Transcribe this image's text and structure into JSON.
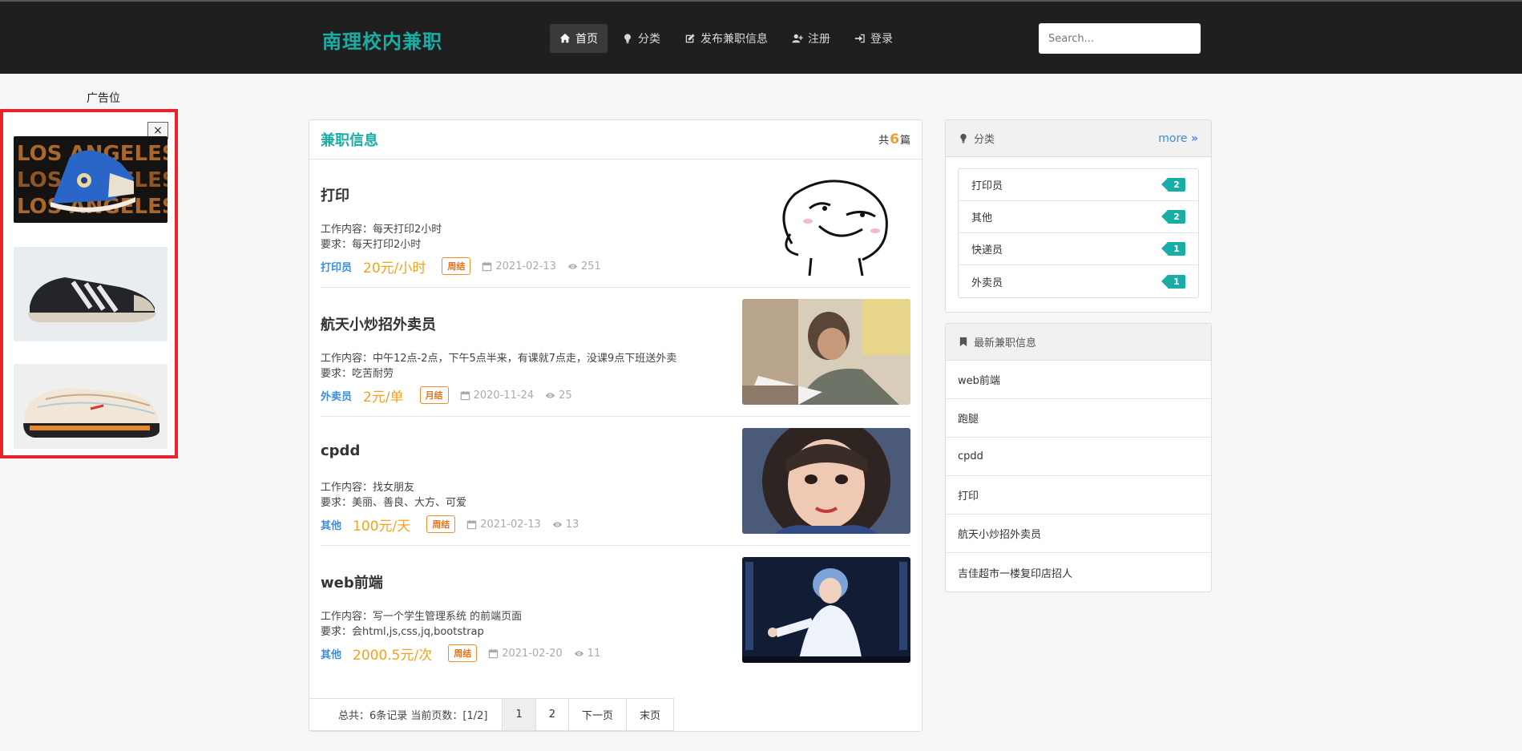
{
  "header": {
    "brand": "南理校内兼职",
    "nav": [
      {
        "label": "首页",
        "icon": "home-icon",
        "active": true
      },
      {
        "label": "分类",
        "icon": "lightbulb-icon"
      },
      {
        "label": "发布兼职信息",
        "icon": "edit-icon"
      },
      {
        "label": "注册",
        "icon": "user-plus-icon"
      },
      {
        "label": "登录",
        "icon": "sign-in-icon"
      }
    ],
    "search_placeholder": "Search..."
  },
  "ad": {
    "label": "广告位",
    "close": "×",
    "banner_text": [
      "LOS ANGELES",
      "LOS ANGELES",
      "LOS ANGELES"
    ]
  },
  "main": {
    "title": "兼职信息",
    "count_prefix": "共",
    "count": "6",
    "count_suffix": "篇",
    "jobs": [
      {
        "title": "打印",
        "content": "工作内容：每天打印2小时",
        "req": "要求：每天打印2小时",
        "cat": "打印员",
        "salary": "20元/小时",
        "tag": "周结",
        "date": "2021-02-13",
        "views": "251"
      },
      {
        "title": "航天小炒招外卖员",
        "content": "工作内容：中午12点-2点，下午5点半来，有课就7点走，没课9点下班送外卖",
        "req": "要求：吃苦耐劳",
        "cat": "外卖员",
        "salary": "2元/单",
        "tag": "月结",
        "date": "2020-11-24",
        "views": "25"
      },
      {
        "title": "cpdd",
        "content": "工作内容：找女朋友",
        "req": "要求：美丽、善良、大方、可爱",
        "cat": "其他",
        "salary": "100元/天",
        "tag": "周结",
        "date": "2021-02-13",
        "views": "13"
      },
      {
        "title": "web前端",
        "content": "工作内容：写一个学生管理系统 的前端页面",
        "req": "要求：会html,js,css,jq,bootstrap",
        "cat": "其他",
        "salary": "2000.5元/次",
        "tag": "周结",
        "date": "2021-02-20",
        "views": "11"
      }
    ],
    "pagination": {
      "info": "总共：6条记录  当前页数：[1/2]",
      "pages": [
        "1",
        "2"
      ],
      "next": "下一页",
      "last": "末页"
    }
  },
  "sidebar": {
    "categories": {
      "title": "分类",
      "more": "more",
      "items": [
        {
          "name": "打印员",
          "count": "2"
        },
        {
          "name": "其他",
          "count": "2"
        },
        {
          "name": "快递员",
          "count": "1"
        },
        {
          "name": "外卖员",
          "count": "1"
        }
      ]
    },
    "latest": {
      "title": "最新兼职信息",
      "items": [
        "web前端",
        "跑腿",
        "cpdd",
        "打印",
        "航天小炒招外卖员",
        "吉佳超市一楼复印店招人"
      ]
    }
  },
  "colors": {
    "brand": "#1aada5",
    "category_link": "#3b8de0",
    "salary": "#f4a21c",
    "tag": "#e5731a",
    "ad_border": "#e8232a"
  }
}
